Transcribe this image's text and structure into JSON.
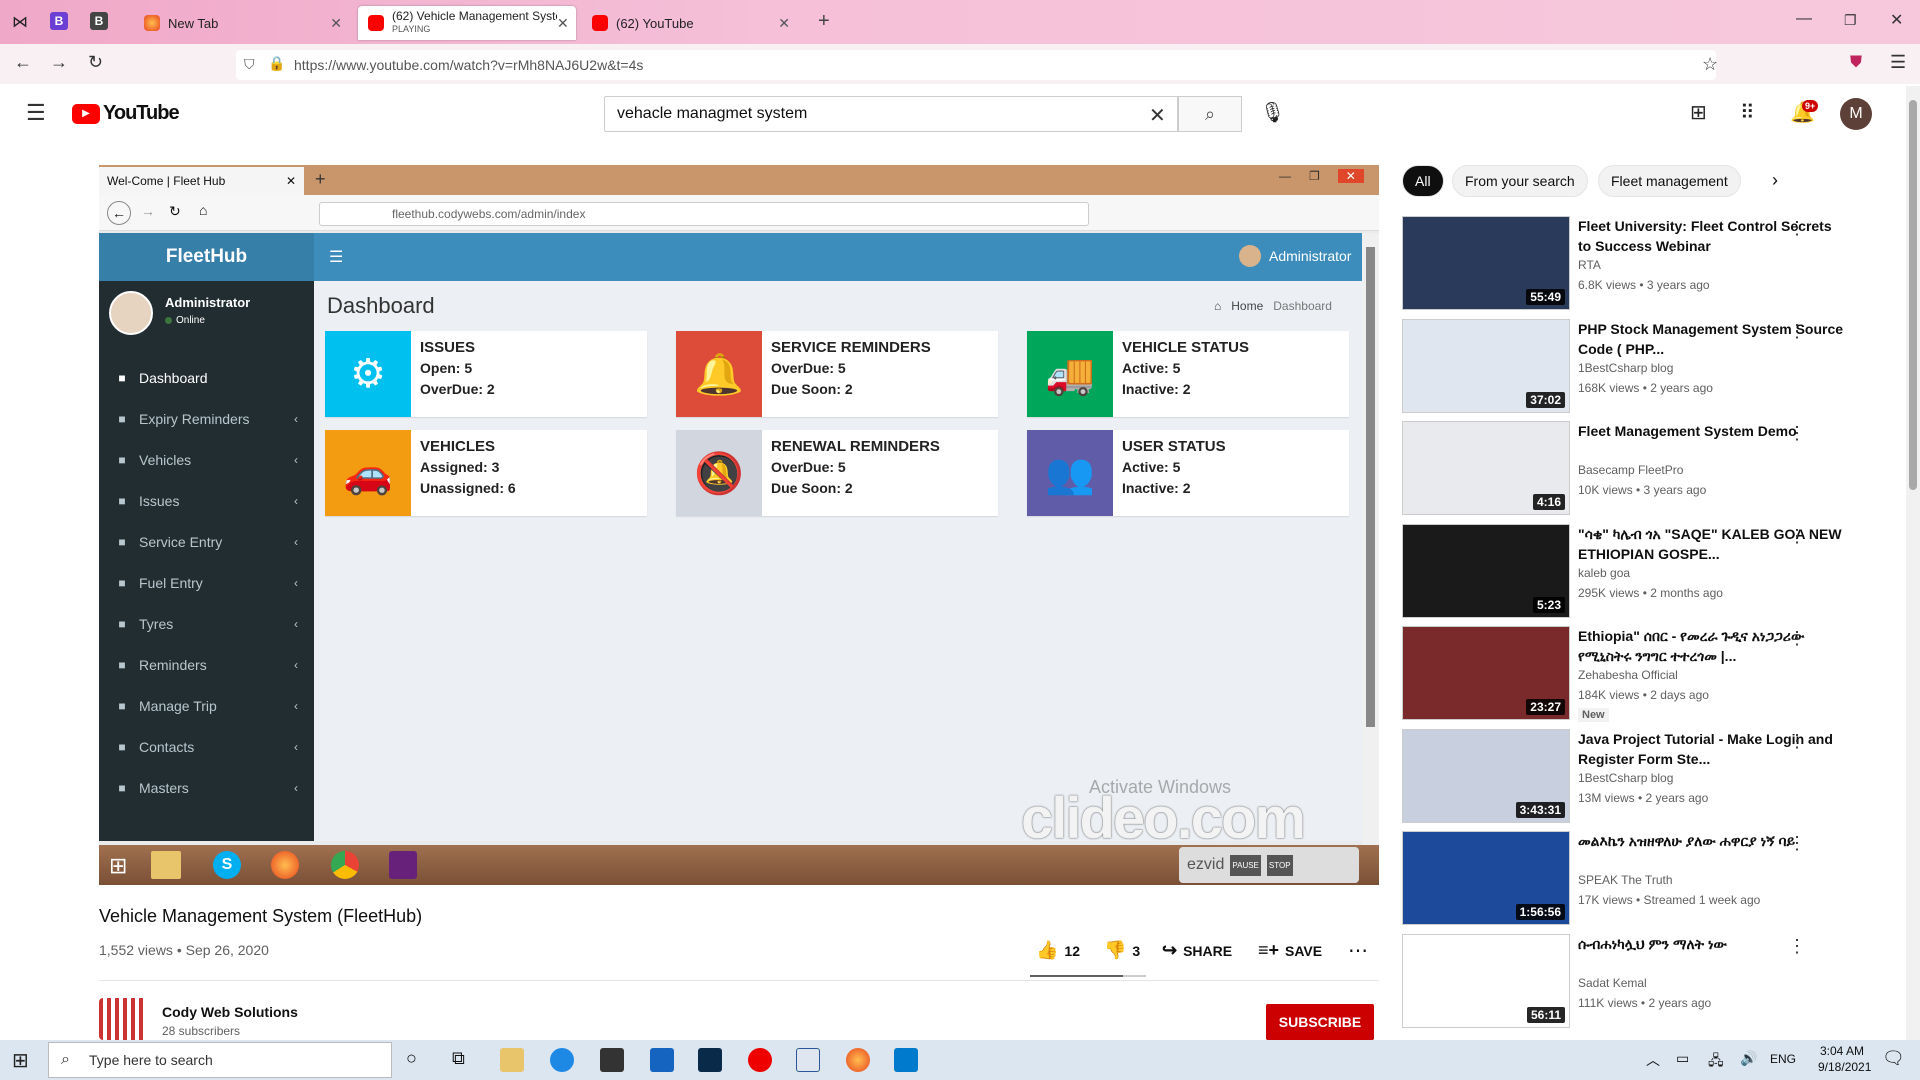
{
  "browser": {
    "tabs": [
      {
        "title": "New Tab",
        "sub": ""
      },
      {
        "title": "(62) Vehicle Management Syste",
        "sub": "PLAYING"
      },
      {
        "title": "(62) YouTube",
        "sub": ""
      }
    ],
    "url": "https://www.youtube.com/watch?v=rMh8NAJ6U2w&t=4s"
  },
  "youtube": {
    "logo_text": "YouTube",
    "search_value": "vehacle managmet system",
    "avatar_letter": "M",
    "notif_count": "9+"
  },
  "video_frame": {
    "inner_tab": "Wel-Come | Fleet Hub",
    "inner_url": "fleethub.codywebs.com/admin/index",
    "app_name": "FleetHub",
    "admin_label": "Administrator",
    "user_name": "Administrator",
    "user_status": "Online",
    "page_title": "Dashboard",
    "breadcrumb_home": "Home",
    "breadcrumb_current": "Dashboard",
    "sidebar": [
      {
        "label": "Dashboard",
        "icon": "dashboard-icon",
        "chev": ""
      },
      {
        "label": "Expiry Reminders",
        "icon": "calendar-icon",
        "chev": "‹"
      },
      {
        "label": "Vehicles",
        "icon": "car-icon",
        "chev": "‹"
      },
      {
        "label": "Issues",
        "icon": "bug-icon",
        "chev": "‹"
      },
      {
        "label": "Service Entry",
        "icon": "wrench-icon",
        "chev": "‹"
      },
      {
        "label": "Fuel Entry",
        "icon": "fuel-icon",
        "chev": "‹"
      },
      {
        "label": "Tyres",
        "icon": "tyre-icon",
        "chev": "‹"
      },
      {
        "label": "Reminders",
        "icon": "bell-icon",
        "chev": "‹"
      },
      {
        "label": "Manage Trip",
        "icon": "random-icon",
        "chev": "‹"
      },
      {
        "label": "Contacts",
        "icon": "contacts-icon",
        "chev": "‹"
      },
      {
        "label": "Masters",
        "icon": "cog-icon",
        "chev": "‹"
      }
    ],
    "cards": [
      {
        "title": "ISSUES",
        "l1": "Open: 5",
        "l2": "OverDue: 2",
        "color": "#00c0ef",
        "glyph": "⚙"
      },
      {
        "title": "SERVICE REMINDERS",
        "l1": "OverDue: 5",
        "l2": "Due Soon: 2",
        "color": "#dd4b39",
        "glyph": "🔔"
      },
      {
        "title": "VEHICLE STATUS",
        "l1": "Active: 5",
        "l2": "Inactive: 2",
        "color": "#00a65a",
        "glyph": "🚚"
      },
      {
        "title": "VEHICLES",
        "l1": "Assigned: 3",
        "l2": "Unassigned: 6",
        "color": "#f39c12",
        "glyph": "🚗"
      },
      {
        "title": "RENEWAL REMINDERS",
        "l1": "OverDue: 5",
        "l2": "Due Soon: 2",
        "color": "#d2d6de",
        "glyph": "🔕"
      },
      {
        "title": "USER STATUS",
        "l1": "Active: 5",
        "l2": "Inactive: 2",
        "color": "#605ca8",
        "glyph": "👥"
      }
    ],
    "watermark_activate": "Activate Windows",
    "watermark_clideo": "clideo.com",
    "ezvid": "ezvid",
    "ezvid_pause": "PAUSE",
    "ezvid_stop": "STOP"
  },
  "video_info": {
    "title": "Vehicle Management System (FleetHub)",
    "meta": "1,552 views • Sep 26, 2020",
    "likes": "12",
    "dislikes": "3",
    "share": "SHARE",
    "save": "SAVE",
    "channel": "Cody Web Solutions",
    "subscribers": "28 subscribers",
    "subscribe": "SUBSCRIBE"
  },
  "chips": [
    "All",
    "From your search",
    "Fleet management"
  ],
  "recommendations": [
    {
      "title": "Fleet University: Fleet Control Secrets to Success Webinar",
      "channel": "RTA",
      "views": "6.8K views • 3 years ago",
      "duration": "55:49",
      "thumb_color": "#2a3a5a",
      "new": ""
    },
    {
      "title": "PHP Stock Management System Source Code ( PHP...",
      "channel": "1BestCsharp blog",
      "views": "168K views • 2 years ago",
      "duration": "37:02",
      "thumb_color": "#dfe6f0",
      "new": ""
    },
    {
      "title": "Fleet Management System Demo",
      "channel": "Basecamp FleetPro",
      "views": "10K views • 3 years ago",
      "duration": "4:16",
      "thumb_color": "#e8eaee",
      "new": ""
    },
    {
      "title": "\"ሳቄ\" ካሌብ ጎአ \"SAQE\" KALEB GOA NEW ETHIOPIAN GOSPE...",
      "channel": "kaleb goa",
      "views": "295K views • 2 months ago",
      "duration": "5:23",
      "thumb_color": "#1a1a1a",
      "new": ""
    },
    {
      "title": "Ethiopia\" ሰበር - የመረራ ጉዲና አነጋጋሪው የሚኒስትሩ ንግግር ተተረጎመ |...",
      "channel": "Zehabesha Official",
      "views": "184K views • 2 days ago",
      "duration": "23:27",
      "thumb_color": "#7a2a2a",
      "new": "New"
    },
    {
      "title": "Java Project Tutorial - Make Login and Register Form Ste...",
      "channel": "1BestCsharp blog",
      "views": "13M views • 2 years ago",
      "duration": "3:43:31",
      "thumb_color": "#c8d0e0",
      "new": ""
    },
    {
      "title": "መልእኬን አዝዘዋለሁ ያለው ሐዋርያ ነኝ ባይ",
      "channel": "SPEAK The Truth",
      "views": "17K views • Streamed 1 week ago",
      "duration": "1:56:56",
      "thumb_color": "#1d4a9a",
      "new": ""
    },
    {
      "title": "ሱብሐነካሏህ ምን ማለት ነው",
      "channel": "Sadat Kemal",
      "views": "111K views • 2 years ago",
      "duration": "56:11",
      "thumb_color": "#ffffff",
      "new": ""
    }
  ],
  "taskbar": {
    "search_placeholder": "Type here to search",
    "lang": "ENG",
    "time": "3:04 AM",
    "date": "9/18/2021"
  }
}
